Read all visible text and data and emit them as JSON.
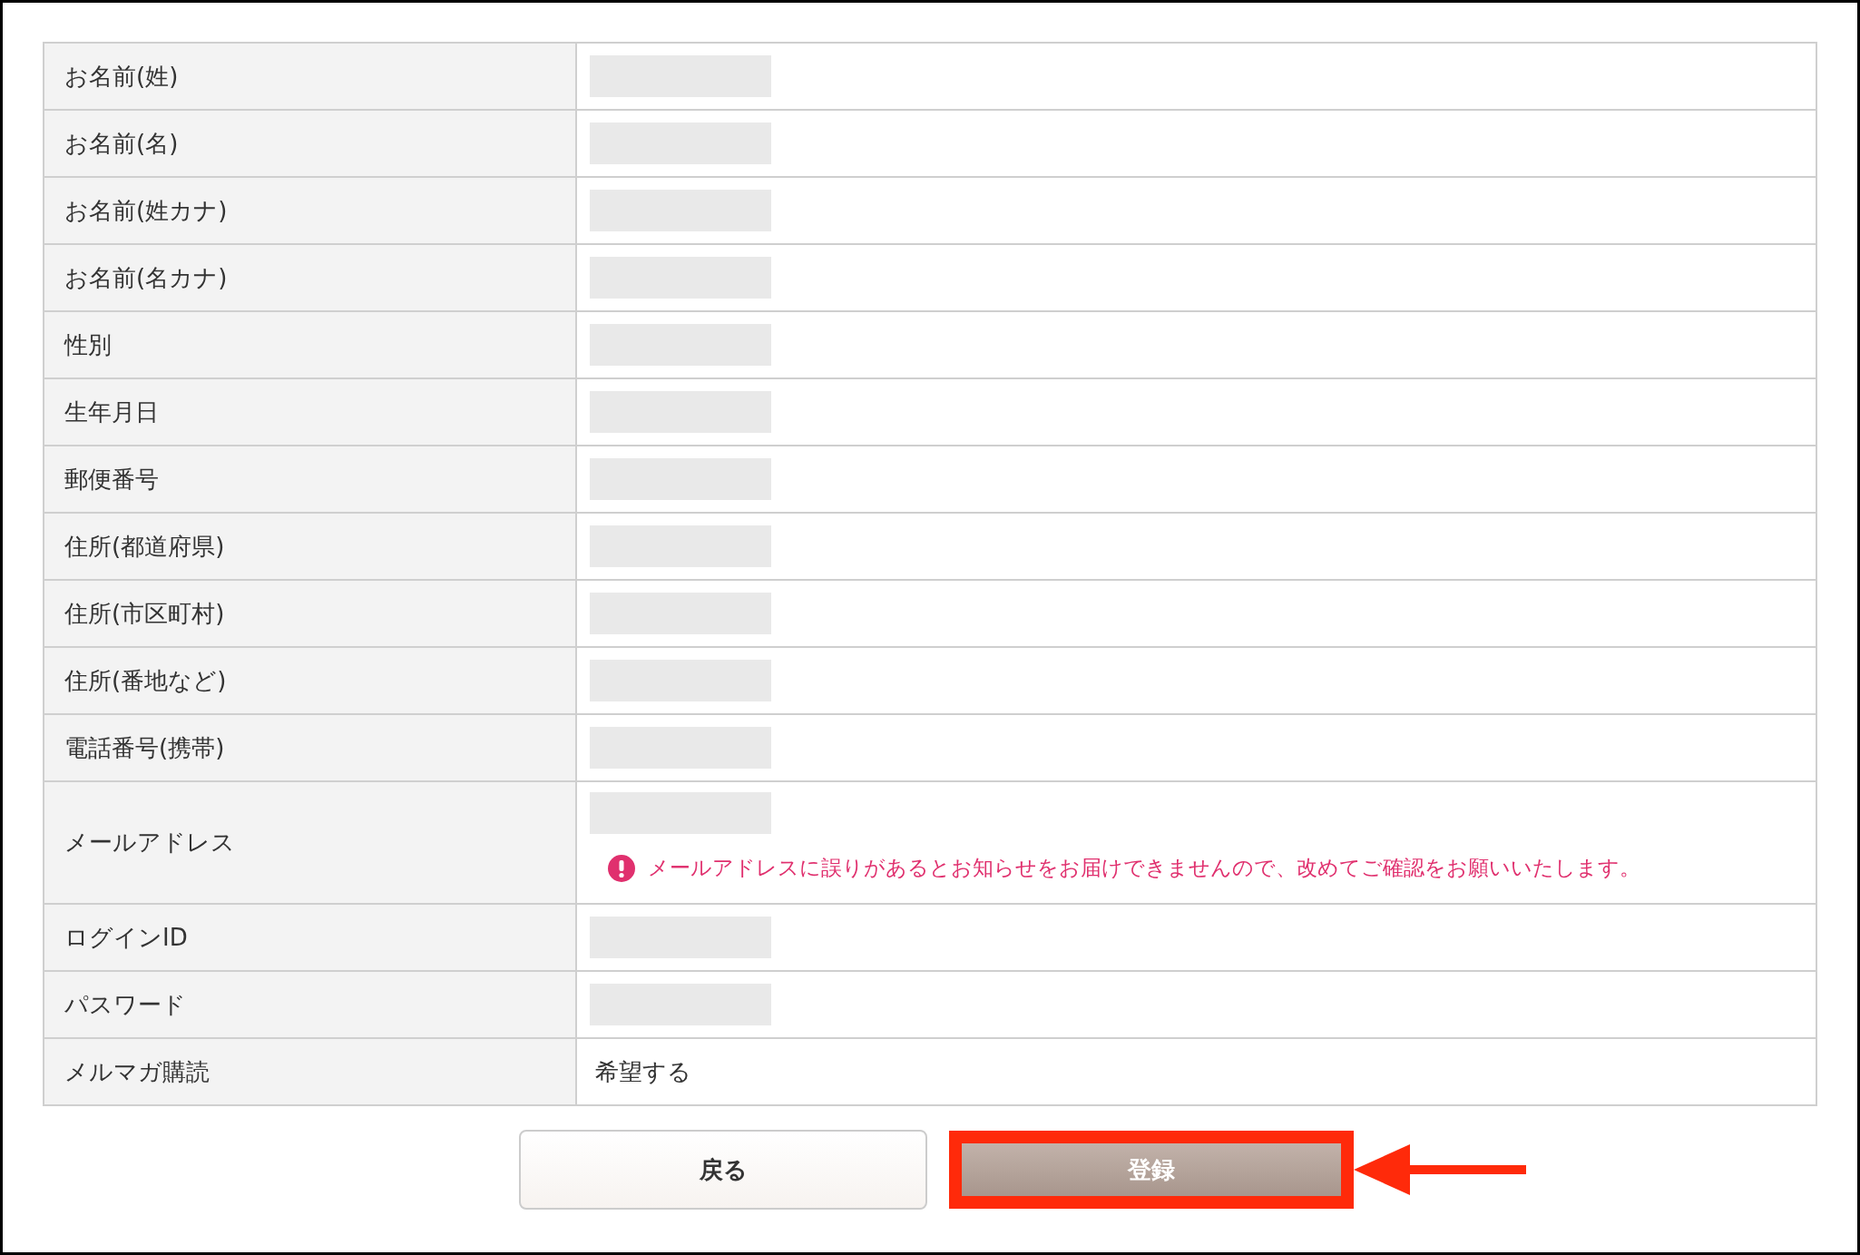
{
  "rows": [
    {
      "label": "お名前(姓)",
      "kind": "masked"
    },
    {
      "label": "お名前(名)",
      "kind": "masked"
    },
    {
      "label": "お名前(姓カナ)",
      "kind": "masked"
    },
    {
      "label": "お名前(名カナ)",
      "kind": "masked"
    },
    {
      "label": "性別",
      "kind": "masked"
    },
    {
      "label": "生年月日",
      "kind": "masked"
    },
    {
      "label": "郵便番号",
      "kind": "masked"
    },
    {
      "label": "住所(都道府県)",
      "kind": "masked"
    },
    {
      "label": "住所(市区町村)",
      "kind": "masked"
    },
    {
      "label": "住所(番地など)",
      "kind": "masked"
    },
    {
      "label": "電話番号(携帯)",
      "kind": "masked"
    },
    {
      "label": "メールアドレス",
      "kind": "masked",
      "notice": "メールアドレスに誤りがあるとお知らせをお届けできませんので、改めてご確認をお願いいたします。"
    },
    {
      "label": "ログインID",
      "kind": "masked"
    },
    {
      "label": "パスワード",
      "kind": "masked"
    },
    {
      "label": "メルマガ購読",
      "kind": "text",
      "value": "希望する"
    }
  ],
  "buttons": [
    {
      "label": "戻る",
      "kind": "secondary",
      "highlighted": false
    },
    {
      "label": "登録",
      "kind": "primary",
      "highlighted": true
    }
  ],
  "pointer_arrow": true
}
